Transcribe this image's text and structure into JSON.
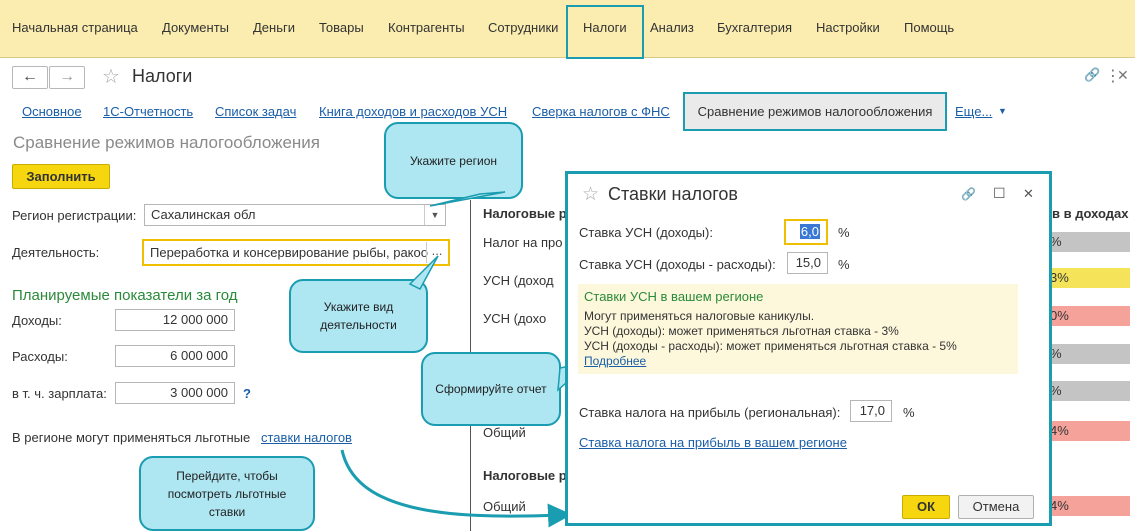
{
  "menu": {
    "items": [
      "Начальная страница",
      "Документы",
      "Деньги",
      "Товары",
      "Контрагенты",
      "Сотрудники",
      "Налоги",
      "Анализ",
      "Бухгалтерия",
      "Настройки",
      "Помощь"
    ]
  },
  "window": {
    "back_icon": "←",
    "forward_icon": "→",
    "star_icon": "☆",
    "title": "Налоги",
    "link_icon": "🔗",
    "more_icon": "⋮",
    "close_icon": "✕"
  },
  "tabs": {
    "items": [
      "Основное",
      "1С-Отчетность",
      "Список задач",
      "Книга доходов и расходов УСН",
      "Сверка налогов с ФНС"
    ],
    "active": "Сравнение режимов налогообложения",
    "more": "Еще...",
    "more_arrow": "▼"
  },
  "page": {
    "heading": "Сравнение режимов налогообложения",
    "fill_button": "Заполнить",
    "region_label": "Регион регистрации:",
    "region_value": "Сахалинская обл",
    "dropdown_icon": "▼",
    "activity_label": "Деятельность:",
    "activity_value": "Переработка и консервирование рыбы, ракоо",
    "activity_more": "...",
    "plan_heading": "Планируемые показатели за год",
    "income_label": "Доходы:",
    "income_value": "12 000 000",
    "expenses_label": "Расходы:",
    "expenses_value": "6 000 000",
    "salary_label": "в т. ч. зарплата:",
    "salary_value": "3 000 000",
    "help_icon": "?",
    "benefit_text": "В регионе могут применяться льготные",
    "benefit_link": "ставки налогов"
  },
  "right_panel": {
    "group1": "Налоговые р",
    "row_nalog": "Налог на про",
    "row_usn_dohod": "УСН (доход",
    "row_usn_dohod2": "УСН (дохо",
    "row_p": "П",
    "row_obshchiy": "Общий",
    "group2": "Налоговые р",
    "row_obshchiy2": "Общий",
    "col_header": "в в доходах",
    "bars": [
      "%",
      "3%",
      "0%",
      "%",
      "%",
      "4%",
      "4%"
    ],
    "bar_colors": [
      "#c4c4c4",
      "#f5e45a",
      "#f4a29a",
      "#c4c4c4",
      "#c4c4c4",
      "#f4a29a",
      "#f4a29a"
    ]
  },
  "callouts": {
    "region": "Укажите регион",
    "activity": "Укажите вид деятельности",
    "report": "Сформируйте отчет",
    "rates": "Перейдите, чтобы посмотреть льготные ставки"
  },
  "dialog": {
    "title": "Ставки налогов",
    "star_icon": "☆",
    "link_icon": "🔗",
    "maximize_icon": "☐",
    "close_icon": "✕",
    "usn_income_label": "Ставка УСН (доходы):",
    "usn_income_value": "6,0",
    "usn_income_unit": "%",
    "usn_ie_label": "Ставка УСН (доходы - расходы):",
    "usn_ie_value": "15,0",
    "usn_ie_unit": "%",
    "region_heading": "Ставки УСН в вашем регионе",
    "region_line1": "Могут применяться налоговые каникулы.",
    "region_line2": "УСН (доходы): может применяться льготная ставка - 3%",
    "region_line3": "УСН (доходы - расходы): может применяться льготная ставка - 5%",
    "region_more": "Подробнее",
    "profit_label": "Ставка налога на прибыль (региональная):",
    "profit_value": "17,0",
    "profit_unit": "%",
    "profit_link": "Ставка налога на прибыль в вашем регионе",
    "ok": "ОК",
    "cancel": "Отмена"
  },
  "colors": {
    "accent": "#1a9db0",
    "menu_bg": "#fbedb0",
    "button_yellow": "#f5d60f",
    "heading_green": "#2a8a3a",
    "link_blue": "#1a5ea8"
  }
}
